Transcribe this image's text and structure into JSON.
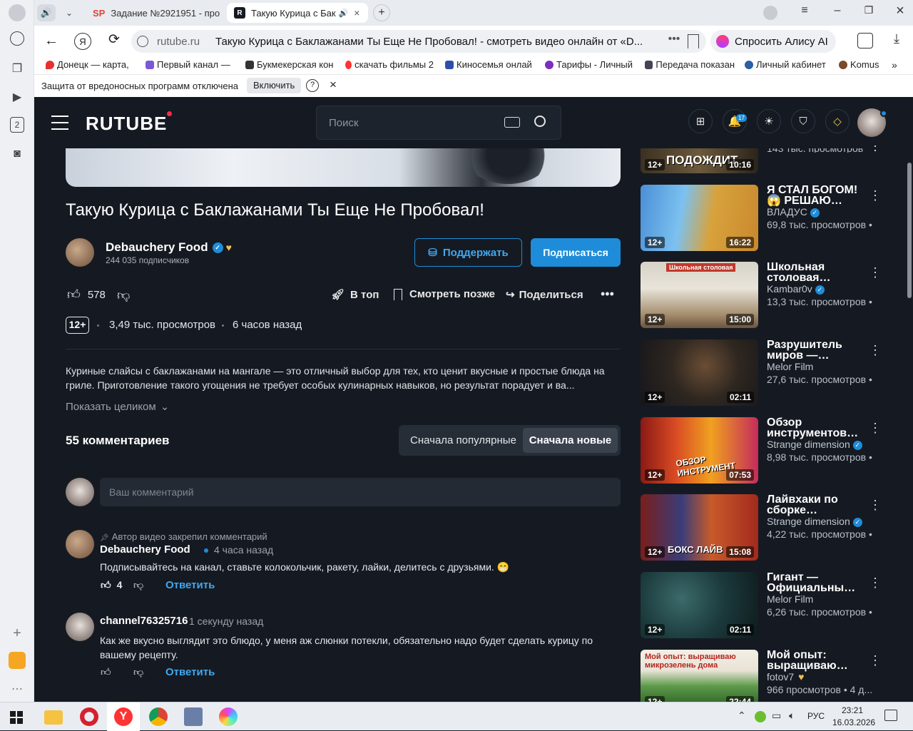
{
  "browser": {
    "tabs": [
      {
        "label": "Задание №2921951 - про",
        "icon": "sp-favicon"
      },
      {
        "label": "Такую Курица с Бак",
        "icon": "rutube-favicon"
      }
    ],
    "url_host": "rutube.ru",
    "page_title": "Такую Курица с Баклажанами Ты Еще Не Пробовал! - смотреть видео онлайн от «D...",
    "alice_label": "Спросить Алису AI",
    "bookmarks": [
      "Донецк — карта, ",
      "Первый канал — ",
      "Букмекерская кон",
      "скачать фильмы 2",
      "Киносемья онлай",
      "Тарифы - Личный",
      "Передача показан",
      "Личный кабинет",
      "Komus"
    ],
    "infobar": {
      "text": "Защита от вредоносных программ отключена",
      "button": "Включить",
      "help": "?",
      "close": "×"
    },
    "rail_badge": "2"
  },
  "rutube": {
    "logo": "RUTUBE",
    "search_placeholder": "Поиск",
    "notif_count": "17"
  },
  "video": {
    "title": "Такую Курица с Баклажанами Ты Еще Не Пробовал!",
    "channel": "Debauchery Food",
    "subscribers": "244 035 подписчиков",
    "support_label": "Поддержать",
    "subscribe_label": "Подписаться",
    "likes": "578",
    "top_label": "В топ",
    "watch_later_label": "Смотреть позже",
    "share_label": "Поделиться",
    "age": "12+",
    "views": "3,49 тыс. просмотров",
    "published": "6 часов назад",
    "description": "Куриные слайсы с баклажанами на мангале — это отличный выбор для тех, кто ценит вкусные и простые блюда на гриле. Приготовление такого угощения не требует особых кулинарных навыков, но результат порадует и ва...",
    "show_more": "Показать целиком"
  },
  "comments": {
    "count_label": "55 комментариев",
    "sort_popular": "Сначала популярные",
    "sort_new": "Сначала новые",
    "input_placeholder": "Ваш комментарий",
    "items": [
      {
        "pinned": "Автор видео закрепил комментарий",
        "author": "Debauchery Food",
        "time": "4 часа назад",
        "text": "Подписывайтесь на канал, ставьте колокольчик, ракету, лайки, делитесь с друзьями. 😁",
        "likes": "4",
        "reply": "Ответить"
      },
      {
        "author": "channel76325716",
        "time": "1 секунду назад",
        "text": "Как же вкусно выглядит это блюдо, у меня аж слюнки потекли, обязательно надо будет сделать курицу по вашему рецепту.",
        "likes": "",
        "reply": "Ответить"
      }
    ]
  },
  "recommended": [
    {
      "title": "",
      "thumb_text": "ПОДОЖДИТ",
      "views": "143 тыс. просмотров",
      "age": "12+",
      "duration": "10:16"
    },
    {
      "title": "Я СТАЛ БОГОМ! 😱 РЕШАЮ…",
      "channel": "ВЛАДУС",
      "verified": true,
      "views": "69,8 тыс. просмотров •",
      "age": "12+",
      "duration": "16:22"
    },
    {
      "title": "Школьная столовая…",
      "channel": "Kambar0v",
      "verified": true,
      "views": "13,3 тыс. просмотров •",
      "age": "12+",
      "duration": "15:00",
      "thumb_text": "Школьная столовая"
    },
    {
      "title": "Разрушитель миров —…",
      "channel": "Melor Film",
      "verified": false,
      "views": "27,6 тыс. просмотров •",
      "age": "12+",
      "duration": "02:11"
    },
    {
      "title": "Обзор инструментов…",
      "channel": "Strange dimension",
      "verified": true,
      "views": "8,98 тыс. просмотров •",
      "age": "12+",
      "duration": "07:53",
      "thumb_text": "ОБЗОР ИНСТРУМЕНТ"
    },
    {
      "title": "Лайвхаки по сборке…",
      "channel": "Strange dimension",
      "verified": true,
      "views": "4,22 тыс. просмотров •",
      "age": "12+",
      "duration": "15:08",
      "thumb_text": "БОКС ЛАЙВ"
    },
    {
      "title": "Гигант — Официальны…",
      "channel": "Melor Film",
      "verified": false,
      "views": "6,26 тыс. просмотров •",
      "age": "12+",
      "duration": "02:11"
    },
    {
      "title": "Мой опыт: выращиваю…",
      "channel": "fotov7",
      "verified": false,
      "views": "966 просмотров • 4 д...",
      "age": "12+",
      "duration": "22:44",
      "thumb_text": "Мой опыт: выращиваю микрозелень дома"
    }
  ],
  "taskbar": {
    "lang": "РУС",
    "time": "23:21",
    "date": "16.03.2026"
  }
}
